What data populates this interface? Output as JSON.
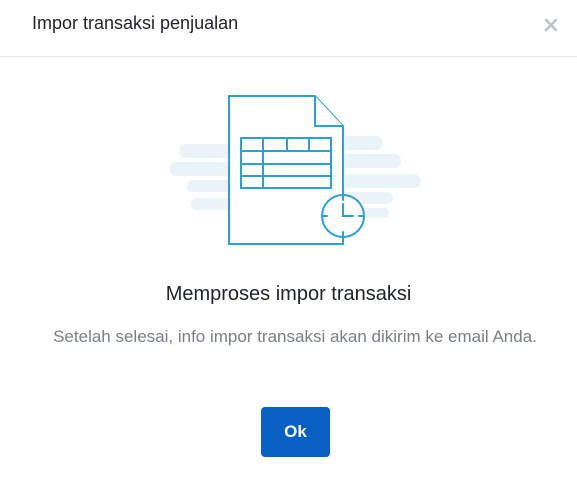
{
  "dialog": {
    "title": "Impor transaksi penjualan",
    "close_icon": "close-icon",
    "illustration_icon": "spreadsheet-document-clock-icon",
    "heading": "Memproses impor transaksi",
    "description": "Setelah selesai, info impor transaksi akan dikirim ke email Anda.",
    "ok_label": "Ok"
  },
  "colors": {
    "accent": "#0a5fc2",
    "icon_stroke": "#2a9fd8",
    "cloud": "#eaf3f8",
    "title_text": "#212529",
    "body_text": "#7a7f85",
    "divider": "#e6e8eb",
    "close_icon": "#bfc3c7"
  }
}
